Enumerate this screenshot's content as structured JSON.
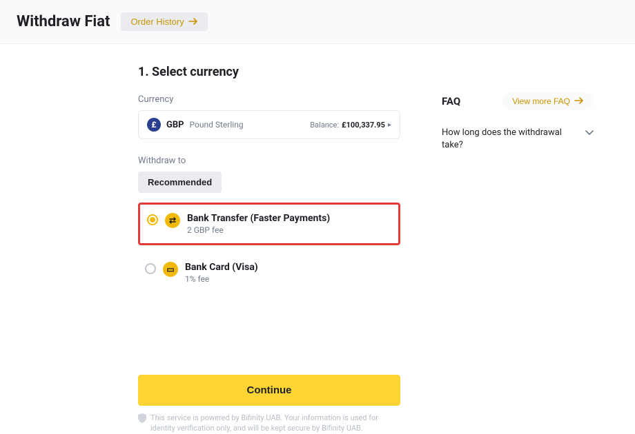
{
  "header": {
    "title": "Withdraw Fiat",
    "order_history_label": "Order History"
  },
  "step": {
    "title": "1. Select currency"
  },
  "currency": {
    "label": "Currency",
    "code": "GBP",
    "name": "Pound Sterling",
    "icon_symbol": "£",
    "balance_label": "Balance:",
    "balance_value": "£100,337.95"
  },
  "withdraw": {
    "label": "Withdraw to",
    "tab_recommended": "Recommended",
    "methods": [
      {
        "title": "Bank Transfer (Faster Payments)",
        "fee": "2 GBP fee",
        "icon_glyph": "⇄",
        "selected": true,
        "highlighted": true
      },
      {
        "title": "Bank Card (Visa)",
        "fee": "1% fee",
        "icon_glyph": "▭",
        "selected": false,
        "highlighted": false
      }
    ]
  },
  "actions": {
    "continue_label": "Continue"
  },
  "disclaimer": {
    "text": "This service is powered by Bifinity UAB. Your information is used for identity verification only, and will be kept secure by Bifinity UAB."
  },
  "faq": {
    "title": "FAQ",
    "view_more_label": "View more FAQ",
    "items": [
      {
        "question": "How long does the withdrawal take?"
      }
    ]
  }
}
